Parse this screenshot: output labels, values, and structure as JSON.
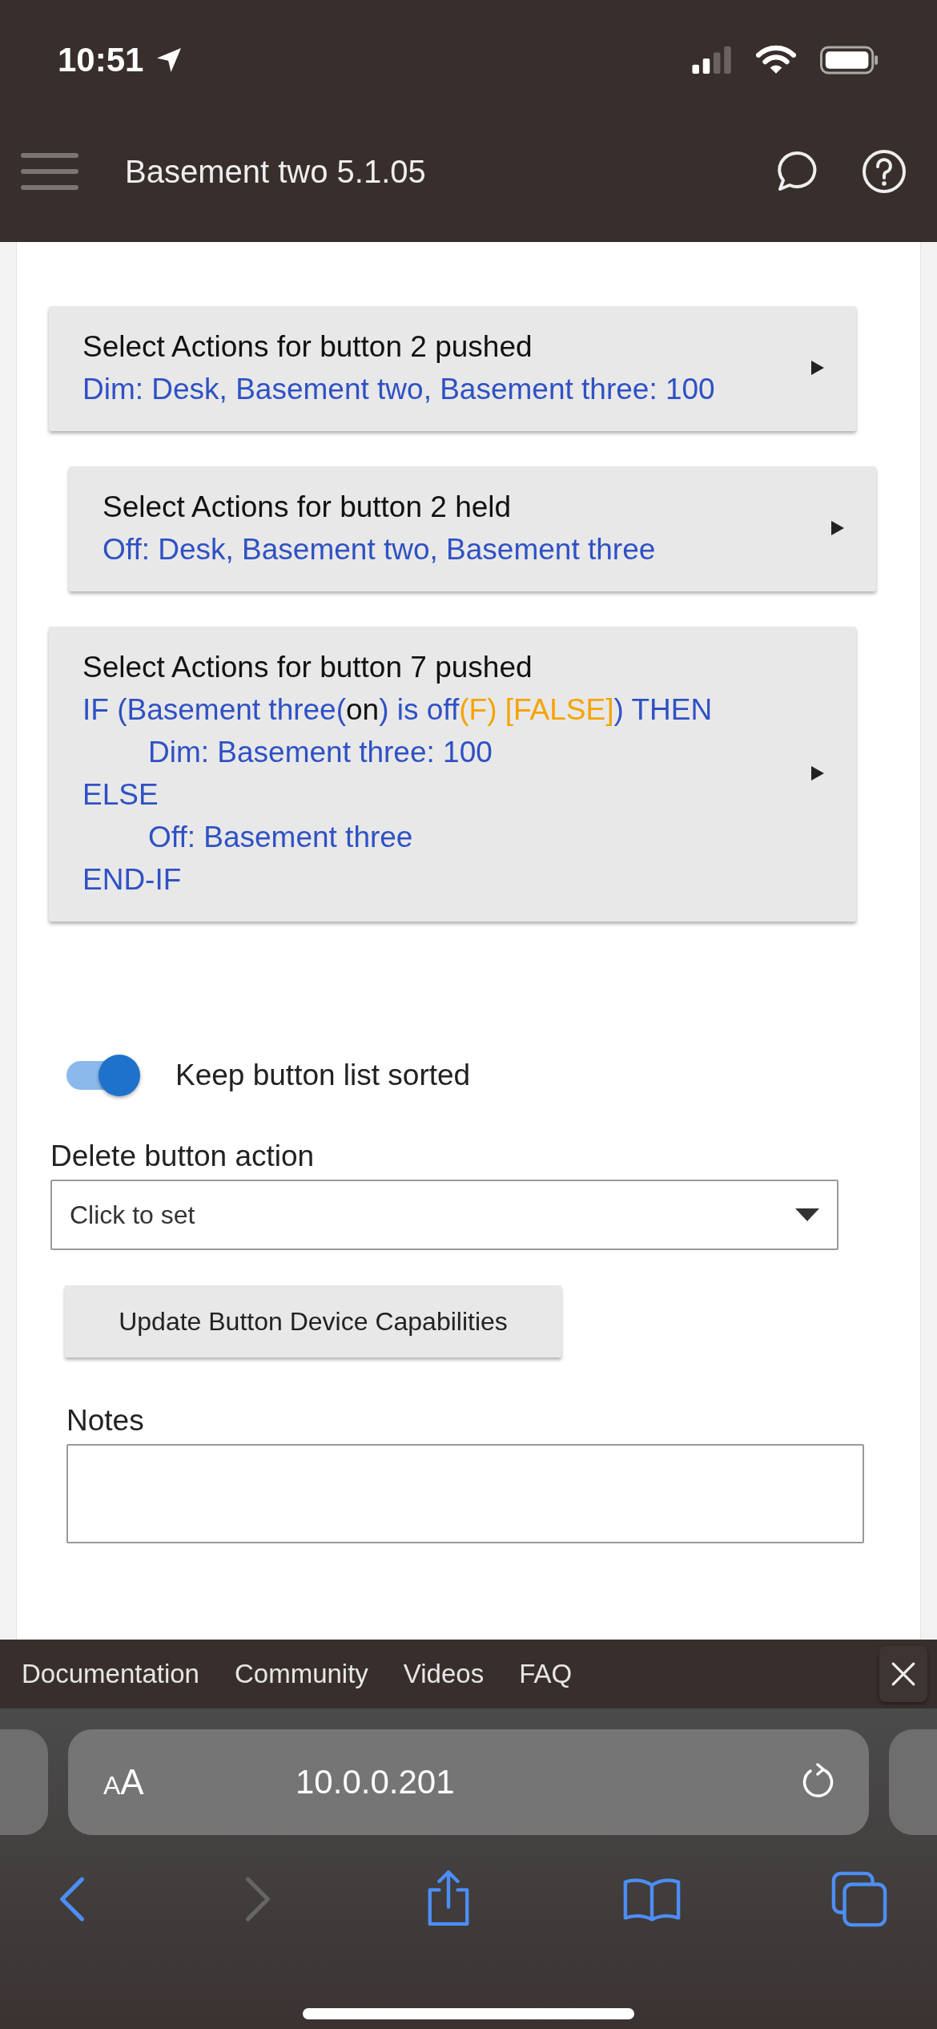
{
  "status_bar": {
    "time": "10:51"
  },
  "app_bar": {
    "title": "Basement two 5.1.05"
  },
  "action_cards": [
    {
      "title": "Select Actions for button 2 pushed",
      "indented": false,
      "lines": [
        {
          "indented": false,
          "segments": [
            {
              "text": "Dim: Desk, Basement two, Basement three: 100",
              "kind": "action"
            }
          ]
        }
      ]
    },
    {
      "title": "Select Actions for button 2 held",
      "indented": true,
      "lines": [
        {
          "indented": false,
          "segments": [
            {
              "text": "Off: Desk, Basement two, Basement three",
              "kind": "action"
            }
          ]
        }
      ]
    },
    {
      "title": "Select Actions for button 7 pushed",
      "indented": false,
      "lines": [
        {
          "indented": false,
          "segments": [
            {
              "text": "IF (Basement three(",
              "kind": "action"
            },
            {
              "text": "on",
              "kind": "state"
            },
            {
              "text": ") is off",
              "kind": "action"
            },
            {
              "text": "(F) [FALSE]",
              "kind": "evaluation"
            },
            {
              "text": ") THEN",
              "kind": "action"
            }
          ]
        },
        {
          "indented": true,
          "segments": [
            {
              "text": "Dim: Basement three: 100",
              "kind": "action"
            }
          ]
        },
        {
          "indented": false,
          "segments": [
            {
              "text": "ELSE",
              "kind": "action"
            }
          ]
        },
        {
          "indented": true,
          "segments": [
            {
              "text": "Off: Basement three",
              "kind": "action"
            }
          ]
        },
        {
          "indented": false,
          "segments": [
            {
              "text": "END-IF",
              "kind": "action"
            }
          ]
        }
      ]
    }
  ],
  "sort_toggle": {
    "label": "Keep button list sorted",
    "on": true
  },
  "delete_action": {
    "label": "Delete button action",
    "value": "Click to set"
  },
  "update_button": "Update Button Device Capabilities",
  "notes": {
    "label": "Notes"
  },
  "help_links": [
    "Documentation",
    "Community",
    "Videos",
    "FAQ"
  ],
  "browser": {
    "text_size_button": "AA",
    "url": "10.0.0.201",
    "back_enabled": true,
    "forward_enabled": false
  }
}
